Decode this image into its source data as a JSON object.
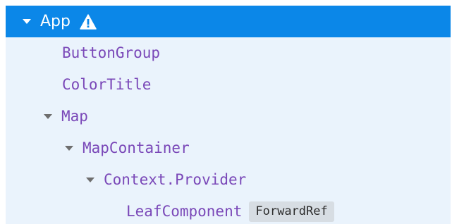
{
  "tree": {
    "selected": {
      "label": "App",
      "expanded_icon": "chevron-down-icon",
      "warning_icon": "warning-icon"
    },
    "items": [
      {
        "label": "ButtonGroup"
      },
      {
        "label": "ColorTitle"
      },
      {
        "label": "Map"
      },
      {
        "label": "MapContainer"
      },
      {
        "label": "Context.Provider"
      },
      {
        "label": "LeafComponent",
        "badge": "ForwardRef"
      }
    ]
  },
  "colors": {
    "selected_bg": "#0b87e8",
    "panel_bg": "#eaf3fc",
    "component_name": "#7a48b8",
    "badge_bg": "#d7dde3"
  }
}
